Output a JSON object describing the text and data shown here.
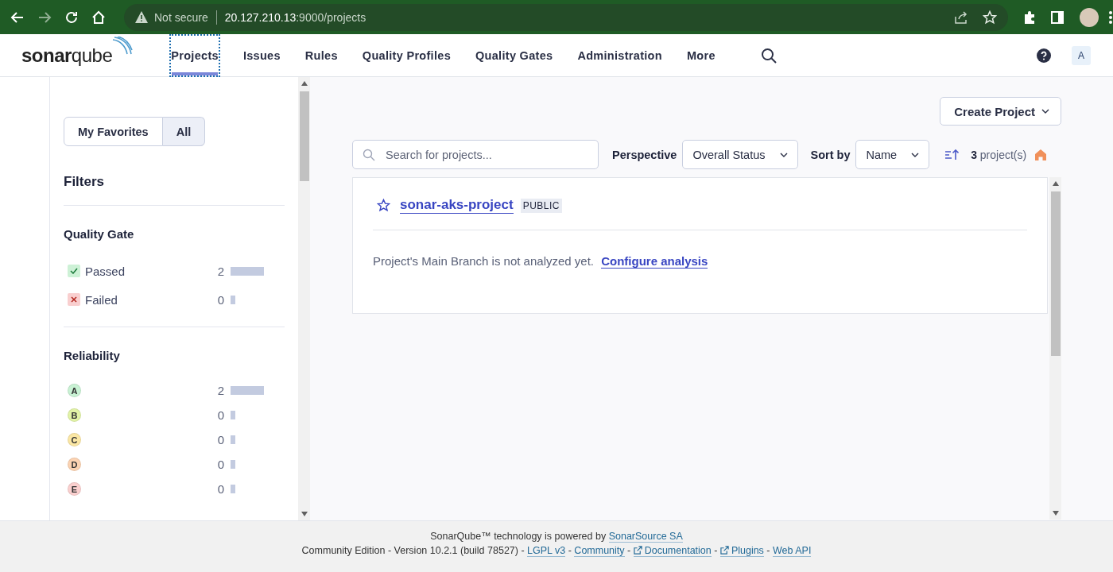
{
  "browser": {
    "security": "Not secure",
    "url_host": "20.127.210.13",
    "url_path": ":9000/projects"
  },
  "nav": {
    "logo": "**sonar**qube",
    "items": [
      {
        "label": "Projects",
        "selected": true
      },
      {
        "label": "Issues",
        "selected": false
      },
      {
        "label": "Rules",
        "selected": false
      },
      {
        "label": "Quality Profiles",
        "selected": false
      },
      {
        "label": "Quality Gates",
        "selected": false
      },
      {
        "label": "Administration",
        "selected": false
      },
      {
        "label": "More",
        "selected": false
      }
    ],
    "avatar": "A"
  },
  "sidebar": {
    "toggle": [
      {
        "label": "My Favorites",
        "selected": false
      },
      {
        "label": "All",
        "selected": true
      }
    ],
    "title": "Filters",
    "facets": [
      {
        "title": "Quality Gate",
        "items": [
          {
            "kind": "passed",
            "label": "Passed",
            "count": "2"
          },
          {
            "kind": "failed",
            "label": "Failed",
            "count": "0"
          }
        ]
      },
      {
        "title": "Reliability",
        "items": [
          {
            "kind": "rating",
            "label": "A",
            "color": "#c9f2d4",
            "count": "2"
          },
          {
            "kind": "rating",
            "label": "B",
            "color": "#e2f3a6",
            "count": "0"
          },
          {
            "kind": "rating",
            "label": "C",
            "color": "#fbe7a4",
            "count": "0"
          },
          {
            "kind": "rating",
            "label": "D",
            "color": "#fcd3b2",
            "count": "0"
          },
          {
            "kind": "rating",
            "label": "E",
            "color": "#fbd0cf",
            "count": "0"
          }
        ]
      }
    ]
  },
  "main": {
    "create_button": "Create Project",
    "search": {
      "placeholder": "Search for projects..."
    },
    "perspective": {
      "label": "Perspective",
      "value": "Overall Status"
    },
    "sort": {
      "label": "Sort by",
      "value": "Name"
    },
    "count": {
      "number": "3",
      "unit": "project(s)"
    },
    "projects": [
      {
        "name": "sonar-aks-project",
        "visibility": "PUBLIC",
        "message": "Project's Main Branch is not analyzed yet.",
        "action": "Configure analysis"
      }
    ]
  },
  "footer": {
    "line_1": [
      {
        "kind": "text",
        "text": "SonarQube™ technology is powered by "
      },
      {
        "kind": "link",
        "text": "SonarSource SA",
        "external": false
      }
    ],
    "line_2": [
      {
        "kind": "text",
        "text": "Community Edition - Version 10.2.1 (build 78527) - "
      },
      {
        "kind": "link",
        "text": "LGPL v3",
        "external": false
      },
      {
        "kind": "text",
        "text": " - "
      },
      {
        "kind": "link",
        "text": "Community",
        "external": false
      },
      {
        "kind": "text",
        "text": " - "
      },
      {
        "kind": "link",
        "text": "Documentation",
        "external": true
      },
      {
        "kind": "text",
        "text": " - "
      },
      {
        "kind": "link",
        "text": "Plugins",
        "external": true
      },
      {
        "kind": "text",
        "text": " - "
      },
      {
        "kind": "link",
        "text": "Web API",
        "external": false
      }
    ]
  }
}
